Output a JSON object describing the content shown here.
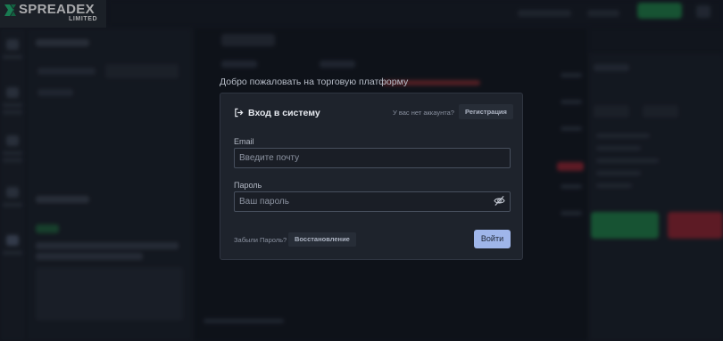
{
  "brand": {
    "name": "SPREADEX",
    "sub": "LIMITED"
  },
  "welcome_text": "Добро пожаловать на торговую платформу",
  "login": {
    "title": "Вход в систему",
    "no_account_text": "У вас нет аккаунта?",
    "register_label": "Регистрация",
    "email_label": "Email",
    "email_placeholder": "Введите почту",
    "email_value": "",
    "password_label": "Пароль",
    "password_placeholder": "Ваш пароль",
    "password_value": "",
    "forgot_text": "Забыли Пароль?",
    "restore_label": "Восстановление",
    "submit_label": "Войти"
  },
  "icons": {
    "title_icon": "login-arrow-icon",
    "password_toggle": "eye-off-icon"
  },
  "colors": {
    "background": "#161b24",
    "modal": "#1e232c",
    "submit_button": "#9fb6ea",
    "brand_green": "#22b573"
  }
}
